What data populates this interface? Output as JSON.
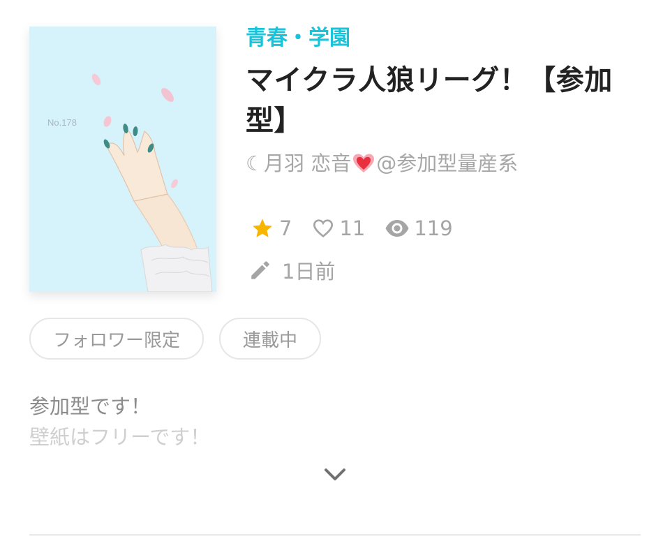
{
  "work": {
    "genre": "青春・学園",
    "title_line1": "マイクラ人狼リーグ！【参加",
    "title_line2": "型】",
    "author_prefix": "☾月羽 恋音",
    "author_suffix": "@参加型量産系",
    "cover_text": "No.178"
  },
  "stats": {
    "stars": "7",
    "likes": "11",
    "views": "119",
    "updated": "1日前"
  },
  "tags": [
    "フォロワー限定",
    "連載中"
  ],
  "description": {
    "line1": "参加型です！",
    "line2": "壁紙はフリーです！"
  },
  "colors": {
    "genre": "#19c3d9",
    "star": "#f7b500",
    "muted_text": "#a5a5a5",
    "cover_background": "#d6f3fb"
  },
  "icons": {
    "star": "star-icon",
    "like": "heart-outline-icon",
    "views": "eye-icon",
    "updated": "pencil-icon",
    "expand": "chevron-down-icon"
  }
}
